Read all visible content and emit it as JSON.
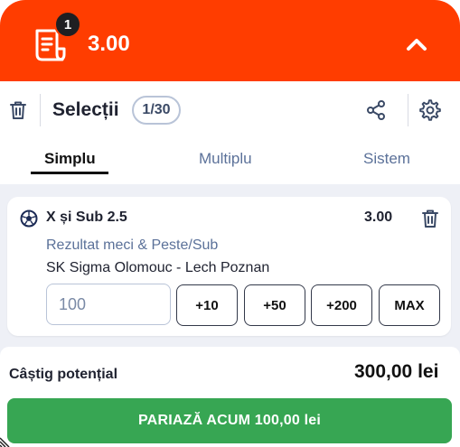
{
  "header": {
    "selection_count": "1",
    "total_odds": "3.00",
    "icons": {
      "slip": "betslip-icon",
      "collapse": "chevron-up-icon"
    }
  },
  "toolbar": {
    "title": "Selecții",
    "count": "1/30",
    "icons": {
      "delete": "trash-icon",
      "share": "share-icon",
      "settings": "gear-icon"
    }
  },
  "tabs": [
    {
      "label": "Simplu",
      "active": true
    },
    {
      "label": "Multiplu",
      "active": false
    },
    {
      "label": "Sistem",
      "active": false
    }
  ],
  "selection": {
    "name": "X și Sub 2.5",
    "odds": "3.00",
    "market": "Rezultat meci & Peste/Sub",
    "event": "SK Sigma Olomouc - Lech Poznan",
    "sport_icon": "football-icon",
    "stake_placeholder": "100",
    "quick_stakes": [
      "+10",
      "+50",
      "+200",
      "MAX"
    ]
  },
  "footer": {
    "win_label": "Câștig potențial",
    "win_value": "300,00 lei",
    "bet_button": "PARIAZĂ ACUM 100,00 lei"
  },
  "colors": {
    "header": "#ff3d00",
    "bet_button": "#37a653",
    "muted_text": "#5b7199",
    "content_bg": "#eef0f6"
  }
}
